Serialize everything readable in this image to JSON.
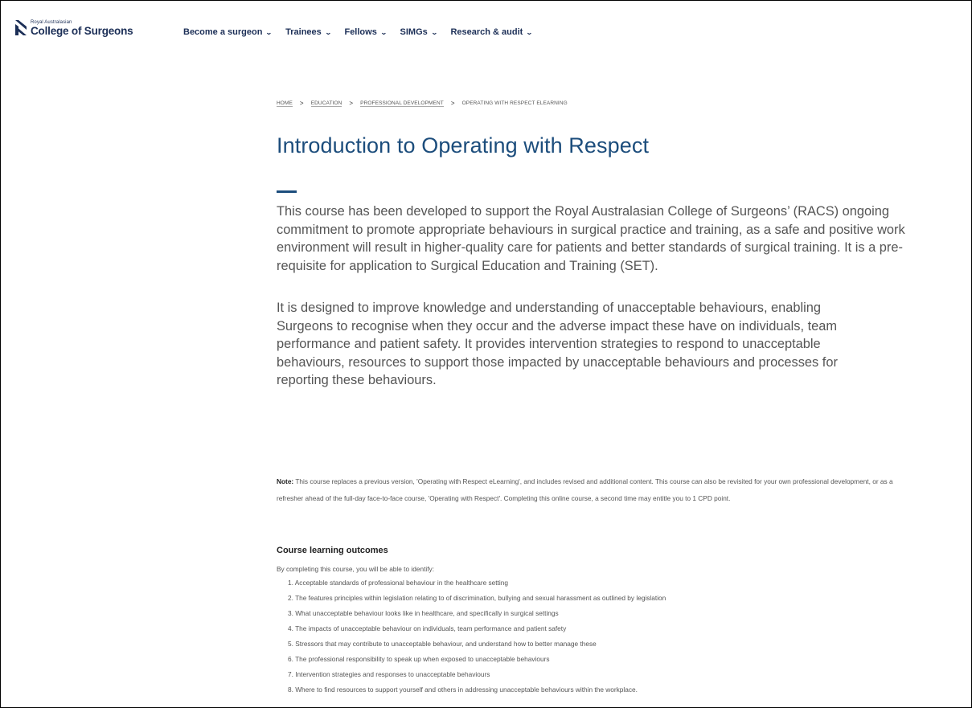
{
  "header": {
    "logo_small": "Royal Australasian",
    "logo_name": "College of Surgeons",
    "brand_color": "#1c2f57",
    "nav": [
      {
        "label": "Become a surgeon",
        "icon": "chevron-down-icon"
      },
      {
        "label": "Trainees",
        "icon": "chevron-down-icon"
      },
      {
        "label": "Fellows",
        "icon": "chevron-down-icon"
      },
      {
        "label": "SIMGs",
        "icon": "chevron-down-icon"
      },
      {
        "label": "Research & audit",
        "icon": "chevron-down-icon"
      }
    ]
  },
  "breadcrumb": {
    "items": [
      "HOME",
      "EDUCATION",
      "PROFESSIONAL DEVELOPMENT",
      "OPERATING WITH RESPECT ELEARNING"
    ],
    "separator": ">"
  },
  "main": {
    "title": "Introduction to Operating with Respect",
    "title_color": "#1c4d7c",
    "intro_1": "This course has been developed to support the Royal Australasian College of Surgeons’ (RACS) ongoing commitment to promote appropriate behaviours in surgical practice and training, as a safe and positive work environment will result in higher-quality care for patients and better standards of surgical training. It is a pre-requisite for application to Surgical Education and Training (SET).",
    "intro_2": "It is designed to improve knowledge and understanding of unacceptable behaviours, enabling Surgeons to recognise when they occur and the adverse impact these have on individuals, team performance and patient safety. It provides intervention strategies to respond to unacceptable behaviours, resources to support those impacted by unacceptable behaviours and processes for reporting these behaviours.",
    "note_label": "Note:",
    "note_text": " This course replaces a previous version, 'Operating with Respect eLearning', and includes revised and additional content. This course can also be revisited for your own professional development, or as a refresher ahead of the full-day face-to-face course, 'Operating with Respect'. Completing this online course, a second time may entitle you to 1 CPD point.",
    "outcomes_heading": "Course learning outcomes",
    "outcomes_intro": "By completing this course, you will be able to identify:",
    "outcomes": [
      "1. Acceptable standards of professional behaviour in the healthcare setting",
      "2. The features principles within legislation relating to of discrimination, bullying and sexual harassment as outlined by legislation",
      "3. What unacceptable behaviour looks like in healthcare, and specifically in surgical settings",
      "4. The impacts of unacceptable behaviour on individuals, team performance and patient safety",
      "5. Stressors that may contribute to unacceptable behaviour, and understand how to better manage these",
      "6. The professional responsibility to speak up when exposed to unacceptable behaviours",
      "7. Intervention strategies and responses to unacceptable behaviours",
      "8. Where to find resources to support yourself and others in addressing unacceptable behaviours within the workplace."
    ]
  }
}
